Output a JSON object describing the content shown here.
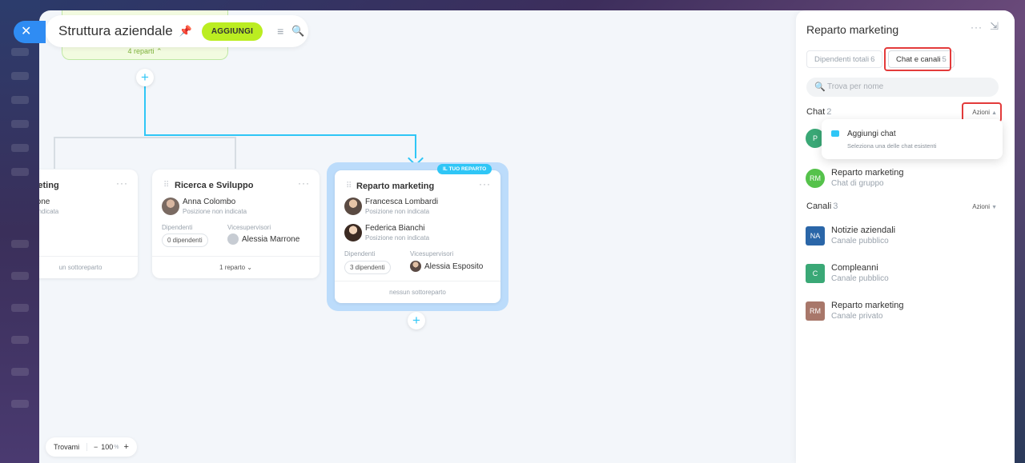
{
  "header": {
    "title": "Struttura aziendale",
    "add_label": "AGGIUNGI"
  },
  "root": {
    "count_label": "4 reparti"
  },
  "departments": [
    {
      "name": "rketing",
      "person_name": "rrone",
      "person_pos": "n indicata",
      "footer": "un sottoreparto"
    },
    {
      "name": "Ricerca e Sviluppo",
      "person_name": "Anna Colombo",
      "person_pos": "Posizione non indicata",
      "emp_label": "Dipendenti",
      "emp_count": "0 dipendenti",
      "vice_label": "Vicesupervisori",
      "vice_name": "Alessia Marrone",
      "footer": "1 reparto"
    },
    {
      "name": "Reparto marketing",
      "badge": "IL TUO REPARTO",
      "person1_name": "Francesca Lombardi",
      "person1_pos": "Posizione non indicata",
      "person2_name": "Federica Bianchi",
      "person2_pos": "Posizione non indicata",
      "emp_label": "Dipendenti",
      "emp_count": "3 dipendenti",
      "vice_label": "Vicesupervisori",
      "vice_name": "Alessia Esposito",
      "footer": "nessun sottoreparto"
    }
  ],
  "zoom": {
    "find_label": "Trovami",
    "value": "100",
    "unit": "%"
  },
  "panel": {
    "title": "Reparto marketing",
    "tabs": [
      {
        "label": "Dipendenti totali",
        "count": "6"
      },
      {
        "label": "Chat e canali",
        "count": "5"
      }
    ],
    "search_placeholder": "Trova per nome",
    "chat_section": {
      "title": "Chat",
      "count": "2",
      "actions": "Azioni"
    },
    "dropdown": {
      "title": "Aggiungi chat",
      "subtitle": "Seleziona una delle chat esistenti"
    },
    "chats": [
      {
        "initials": "P",
        "name": "",
        "sub": "",
        "color": "#3aa876"
      },
      {
        "initials": "RM",
        "name": "Reparto marketing",
        "sub": "Chat di gruppo",
        "color": "#55c24b"
      }
    ],
    "channel_section": {
      "title": "Canali",
      "count": "3",
      "actions": "Azioni"
    },
    "channels": [
      {
        "initials": "NA",
        "name": "Notizie aziendali",
        "sub": "Canale pubblico",
        "color": "#2a66a8"
      },
      {
        "initials": "C",
        "name": "Compleanni",
        "sub": "Canale pubblico",
        "color": "#3aa876"
      },
      {
        "initials": "RM",
        "name": "Reparto marketing",
        "sub": "Canale privato",
        "color": "#a8776a"
      }
    ]
  }
}
